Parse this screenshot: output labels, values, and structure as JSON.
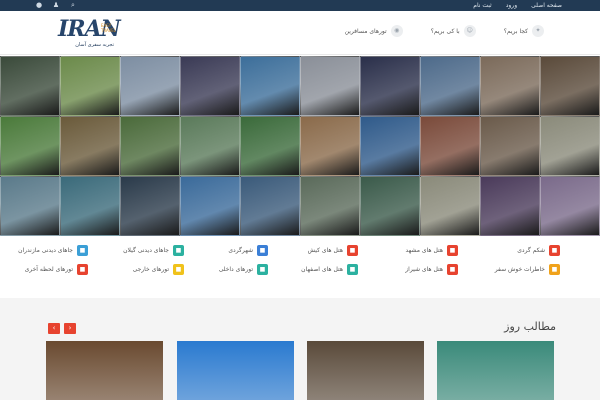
{
  "topbar": {
    "links": [
      "صفحه اصلی",
      "ورود",
      "ثبت نام"
    ],
    "icons": [
      "rss-icon",
      "user-icon",
      "search-icon"
    ]
  },
  "header": {
    "logo_text": "IRAN",
    "logo_sub": "EASY TRAVEL",
    "logo_tagline": "تجربه سفری آسان",
    "nav": [
      {
        "label": "کجا بریم؟",
        "icon": "compass-icon"
      },
      {
        "label": "با کی بریم؟",
        "icon": "people-icon"
      },
      {
        "label": "تورهای مسافرین",
        "icon": "tour-icon"
      }
    ]
  },
  "grid": {
    "colors": [
      "#3a4a3a",
      "#6b8a4a",
      "#7d8ea2",
      "#3a3a55",
      "#3c6e9a",
      "#8a8f98",
      "#2a2f4a",
      "#4d6a8a",
      "#7b6a5a",
      "#5a4a3a",
      "#4a7a3a",
      "#6a5a3a",
      "#4a6a3a",
      "#5a7a5a",
      "#3a6a3a",
      "#8a6a4a",
      "#2f5a8a",
      "#7a4a3a",
      "#6a5a4a",
      "#8a8a7a",
      "#5a7a8a",
      "#3a6a7a",
      "#2a3a4a",
      "#3a6a9a",
      "#3a5a7a",
      "#5a6a5a",
      "#3a5a4a",
      "#8a8a7a",
      "#4a3a5a",
      "#7a6a8a"
    ]
  },
  "categories": [
    {
      "label": "شکم گردی",
      "color": "#e7432f",
      "icon": "fork-icon"
    },
    {
      "label": "هتل های مشهد",
      "color": "#e7432f",
      "icon": "hotel-icon"
    },
    {
      "label": "هتل های کیش",
      "color": "#e7432f",
      "icon": "hotel-icon"
    },
    {
      "label": "شهرگردی",
      "color": "#3b7fd6",
      "icon": "pin-icon"
    },
    {
      "label": "جاهای دیدنی گیلان",
      "color": "#2cb1a0",
      "icon": "pin-icon"
    },
    {
      "label": "جاهای دیدنی مازندران",
      "color": "#3b9fd6",
      "icon": "pin-icon"
    },
    {
      "label": "خاطرات خوش سفر",
      "color": "#f0a21b",
      "icon": "edit-icon"
    },
    {
      "label": "هتل های شیراز",
      "color": "#e7432f",
      "icon": "hotel-icon"
    },
    {
      "label": "هتل های اصفهان",
      "color": "#2cb1a0",
      "icon": "hotel-icon"
    },
    {
      "label": "تورهای داخلی",
      "color": "#2cb1a0",
      "icon": "bus-icon"
    },
    {
      "label": "تورهای خارجی",
      "color": "#f0c21b",
      "icon": "plane-icon"
    },
    {
      "label": "تورهای لحظه آخری",
      "color": "#e7432f",
      "icon": "clock-icon"
    }
  ],
  "section": {
    "title": "مطالب روز",
    "prev": "‹",
    "next": "›"
  },
  "cards": [
    {
      "color": "#6a4a30"
    },
    {
      "color": "#2a7ad0"
    },
    {
      "color": "#5a4a3a"
    },
    {
      "color": "#3a8a7a"
    }
  ]
}
